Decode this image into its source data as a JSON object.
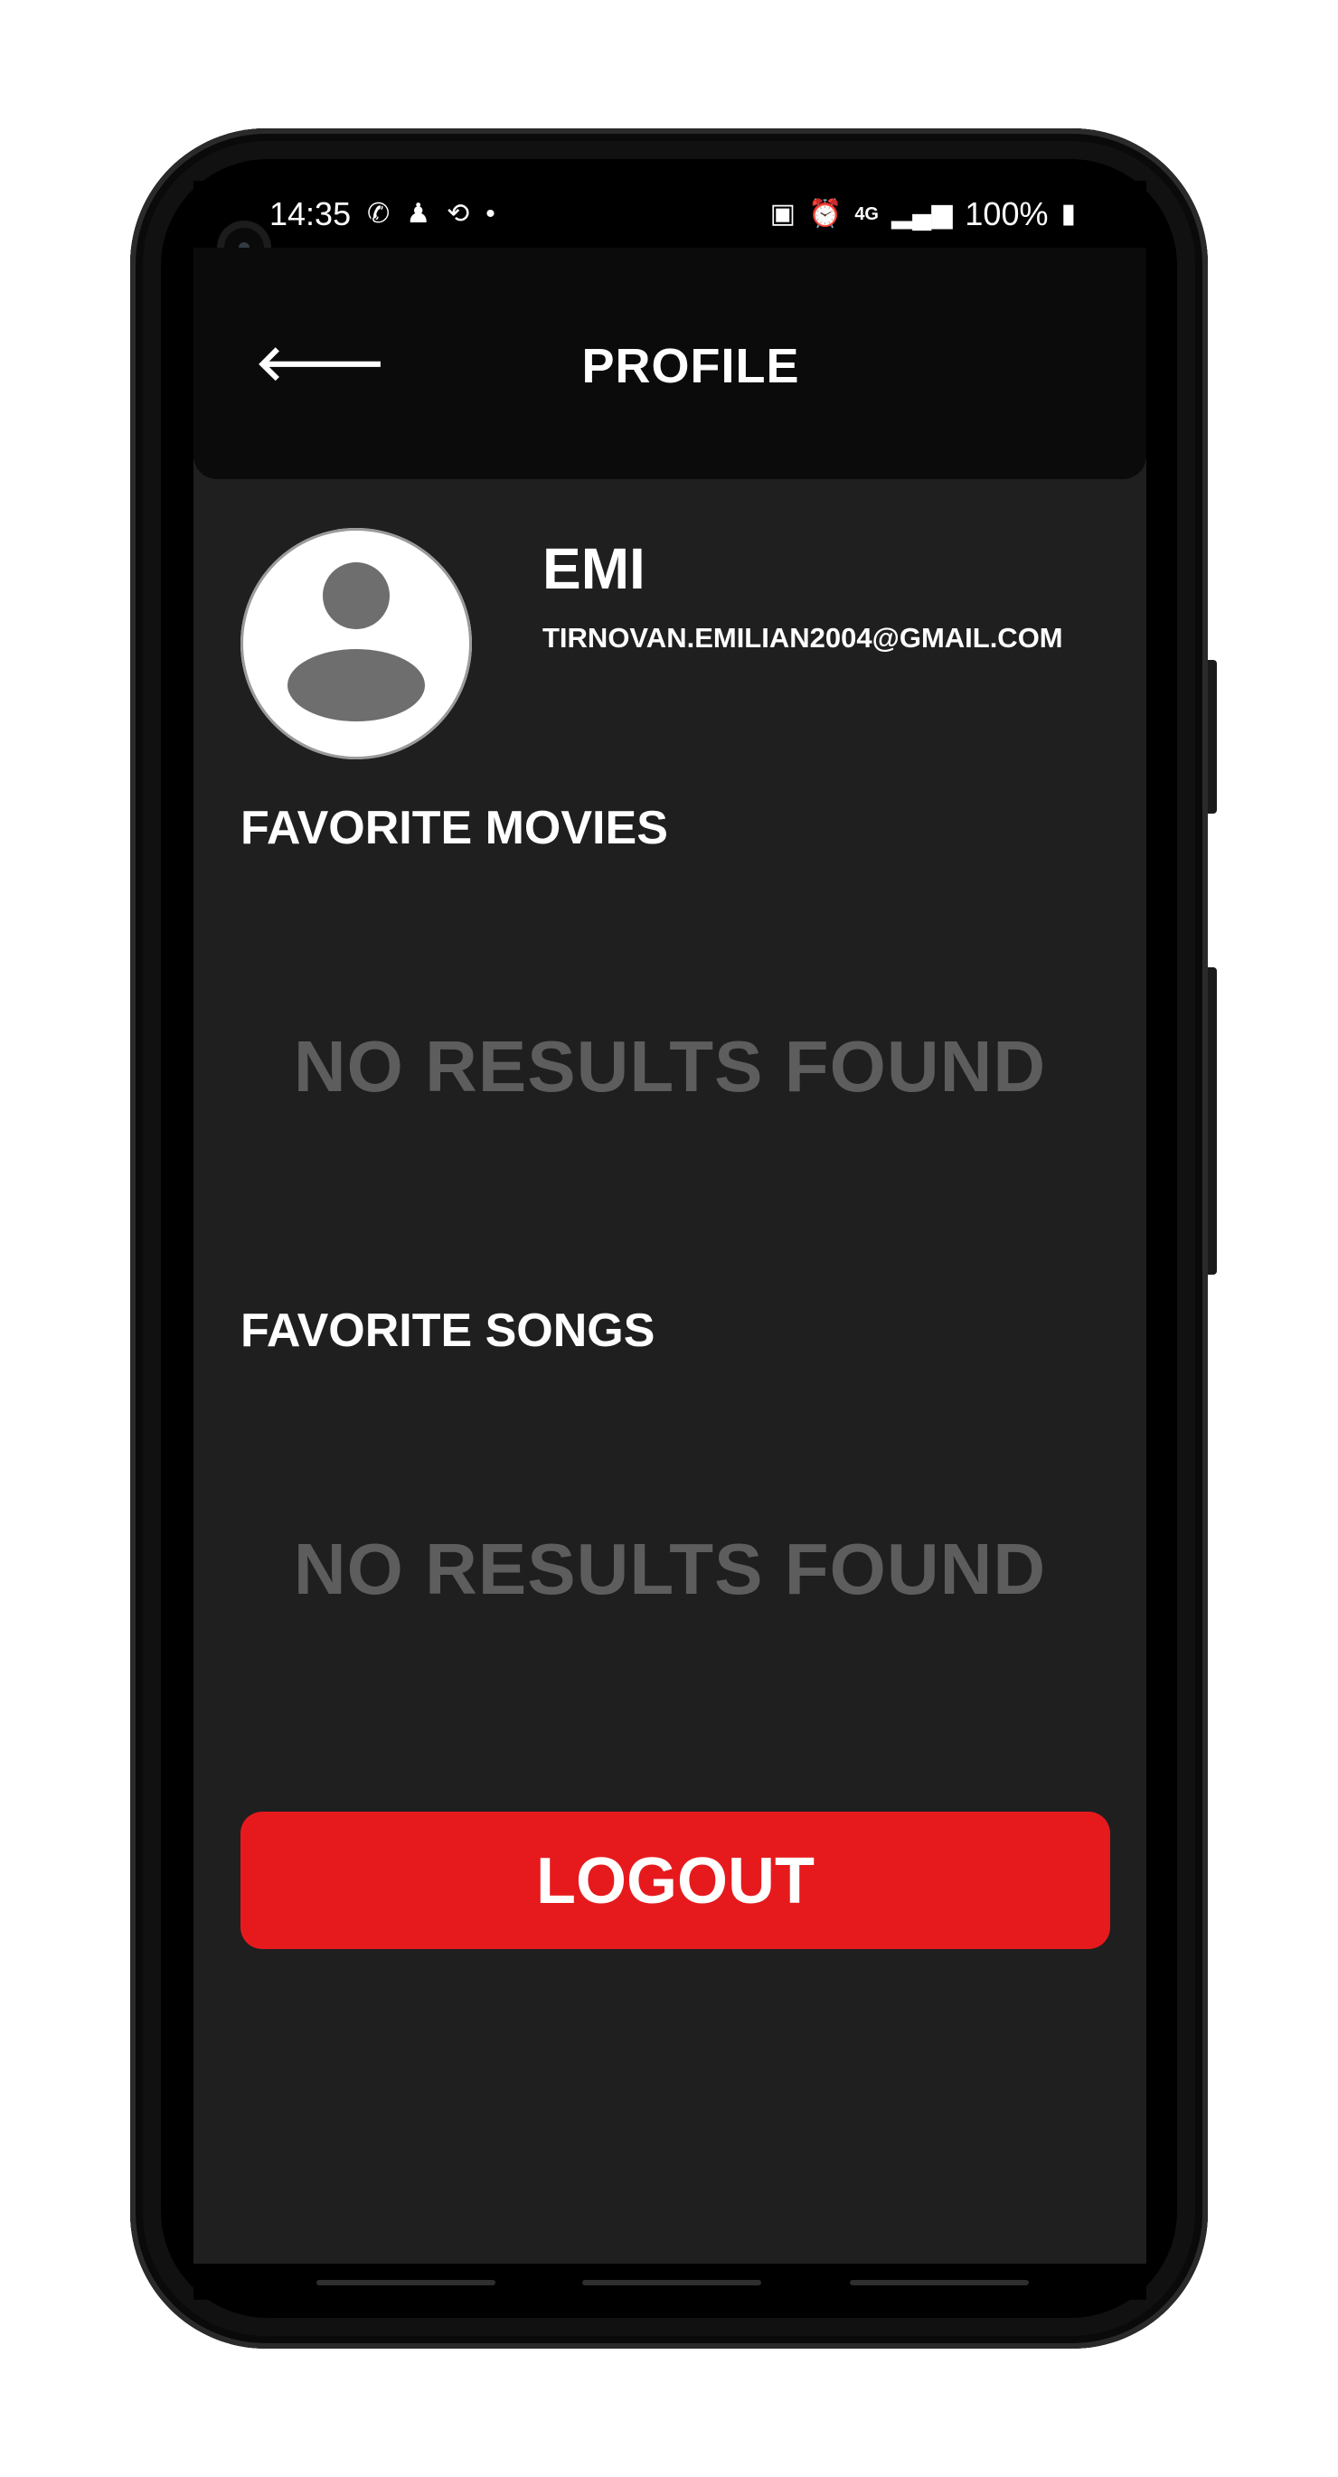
{
  "status_bar": {
    "time": "14:35",
    "battery": "100%",
    "network": "4G",
    "left_icons": [
      "whatsapp-icon",
      "notification-icon",
      "app-icon"
    ],
    "right_icons": [
      "battery-saver-icon",
      "alarm-icon",
      "network-4g-icon",
      "signal-icon",
      "battery-icon"
    ]
  },
  "header": {
    "title": "PROFILE",
    "back_icon": "arrow-left-icon"
  },
  "profile": {
    "name": "EMI",
    "email": "TIRNOVAN.EMILIAN2004@GMAIL.COM",
    "avatar_icon": "default-avatar-icon"
  },
  "sections": [
    {
      "title": "FAVORITE MOVIES",
      "empty_text": "NO RESULTS FOUND"
    },
    {
      "title": "FAVORITE SONGS",
      "empty_text": "NO RESULTS FOUND"
    }
  ],
  "logout_label": "LOGOUT",
  "colors": {
    "background": "#1f1f1f",
    "header": "#0b0b0b",
    "accent": "#e61a1d",
    "muted_text": "#5d5d5d"
  }
}
